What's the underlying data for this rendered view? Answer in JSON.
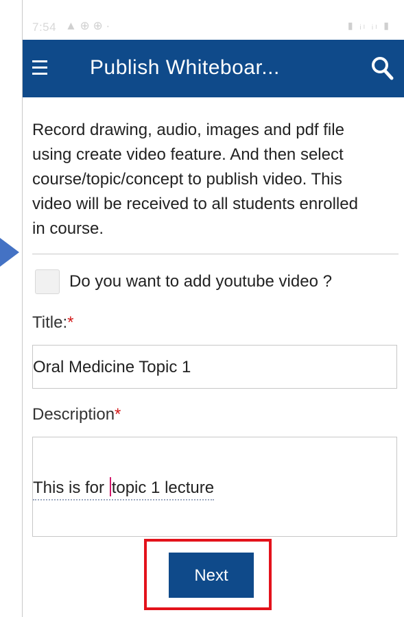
{
  "status_bar": {
    "time": "7:54",
    "left_icons": "▲ ⊕ ⊕ ·",
    "right_icons": "▮ ᵢₗ ᵢₗ ▮"
  },
  "app_bar": {
    "title": "Publish Whiteboar...",
    "menu_icon": "menu-icon",
    "search_icon": "search-icon",
    "color": "#0f4a8a"
  },
  "intro_text": "Record drawing, audio, images and pdf file using create video feature. And then select course/topic/concept to publish video. This video will be received to all students enrolled in course.",
  "youtube_checkbox": {
    "label": "Do you want to add youtube video ?",
    "checked": false
  },
  "title_field": {
    "label": "Title:",
    "required_mark": "*",
    "value": "Oral Medicine Topic 1"
  },
  "description_field": {
    "label": "Description",
    "required_mark": "*",
    "value_before_caret": "This is for ",
    "value_after_caret": "topic 1 lecture"
  },
  "next_button": {
    "label": "Next",
    "highlight_color": "#e3121b"
  }
}
